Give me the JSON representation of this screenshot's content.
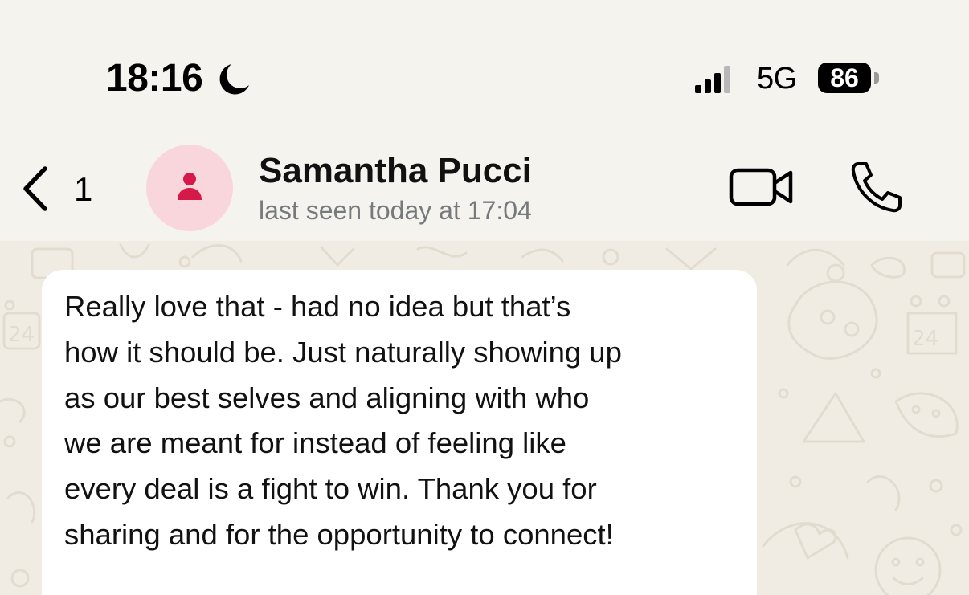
{
  "status_bar": {
    "time": "18:16",
    "network": "5G",
    "battery": "86",
    "icons": [
      "moon-icon",
      "signal-icon",
      "battery-icon"
    ]
  },
  "header": {
    "back_count": "1",
    "contact_name": "Samantha Pucci",
    "last_seen": "last seen today at 17:04",
    "icons": [
      "chevron-left-icon",
      "person-icon",
      "video-camera-icon",
      "phone-icon"
    ]
  },
  "message": {
    "lines": [
      "Really love that - had no idea but that’s",
      "how it should be. Just naturally showing up",
      "as our best selves and aligning with who",
      "we are meant for instead of feeling like",
      "every deal is a fight to win. Thank you for",
      "sharing and for the opportunity to connect!"
    ]
  },
  "colors": {
    "chat_background": "#f1ece3",
    "bubble": "#ffffff",
    "avatar_bg": "#f8d6dc",
    "avatar_icon": "#d51a4a",
    "secondary_text": "#777a7c"
  }
}
